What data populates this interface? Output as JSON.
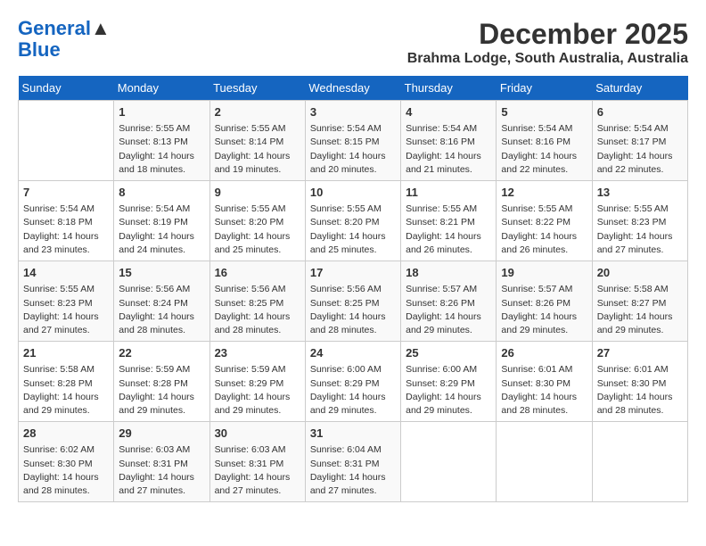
{
  "header": {
    "logo_line1": "General",
    "logo_line2": "Blue",
    "month": "December 2025",
    "location": "Brahma Lodge, South Australia, Australia"
  },
  "weekdays": [
    "Sunday",
    "Monday",
    "Tuesday",
    "Wednesday",
    "Thursday",
    "Friday",
    "Saturday"
  ],
  "weeks": [
    [
      {
        "day": "",
        "sunrise": "",
        "sunset": "",
        "daylight": ""
      },
      {
        "day": "1",
        "sunrise": "Sunrise: 5:55 AM",
        "sunset": "Sunset: 8:13 PM",
        "daylight": "Daylight: 14 hours and 18 minutes."
      },
      {
        "day": "2",
        "sunrise": "Sunrise: 5:55 AM",
        "sunset": "Sunset: 8:14 PM",
        "daylight": "Daylight: 14 hours and 19 minutes."
      },
      {
        "day": "3",
        "sunrise": "Sunrise: 5:54 AM",
        "sunset": "Sunset: 8:15 PM",
        "daylight": "Daylight: 14 hours and 20 minutes."
      },
      {
        "day": "4",
        "sunrise": "Sunrise: 5:54 AM",
        "sunset": "Sunset: 8:16 PM",
        "daylight": "Daylight: 14 hours and 21 minutes."
      },
      {
        "day": "5",
        "sunrise": "Sunrise: 5:54 AM",
        "sunset": "Sunset: 8:16 PM",
        "daylight": "Daylight: 14 hours and 22 minutes."
      },
      {
        "day": "6",
        "sunrise": "Sunrise: 5:54 AM",
        "sunset": "Sunset: 8:17 PM",
        "daylight": "Daylight: 14 hours and 22 minutes."
      }
    ],
    [
      {
        "day": "7",
        "sunrise": "Sunrise: 5:54 AM",
        "sunset": "Sunset: 8:18 PM",
        "daylight": "Daylight: 14 hours and 23 minutes."
      },
      {
        "day": "8",
        "sunrise": "Sunrise: 5:54 AM",
        "sunset": "Sunset: 8:19 PM",
        "daylight": "Daylight: 14 hours and 24 minutes."
      },
      {
        "day": "9",
        "sunrise": "Sunrise: 5:55 AM",
        "sunset": "Sunset: 8:20 PM",
        "daylight": "Daylight: 14 hours and 25 minutes."
      },
      {
        "day": "10",
        "sunrise": "Sunrise: 5:55 AM",
        "sunset": "Sunset: 8:20 PM",
        "daylight": "Daylight: 14 hours and 25 minutes."
      },
      {
        "day": "11",
        "sunrise": "Sunrise: 5:55 AM",
        "sunset": "Sunset: 8:21 PM",
        "daylight": "Daylight: 14 hours and 26 minutes."
      },
      {
        "day": "12",
        "sunrise": "Sunrise: 5:55 AM",
        "sunset": "Sunset: 8:22 PM",
        "daylight": "Daylight: 14 hours and 26 minutes."
      },
      {
        "day": "13",
        "sunrise": "Sunrise: 5:55 AM",
        "sunset": "Sunset: 8:23 PM",
        "daylight": "Daylight: 14 hours and 27 minutes."
      }
    ],
    [
      {
        "day": "14",
        "sunrise": "Sunrise: 5:55 AM",
        "sunset": "Sunset: 8:23 PM",
        "daylight": "Daylight: 14 hours and 27 minutes."
      },
      {
        "day": "15",
        "sunrise": "Sunrise: 5:56 AM",
        "sunset": "Sunset: 8:24 PM",
        "daylight": "Daylight: 14 hours and 28 minutes."
      },
      {
        "day": "16",
        "sunrise": "Sunrise: 5:56 AM",
        "sunset": "Sunset: 8:25 PM",
        "daylight": "Daylight: 14 hours and 28 minutes."
      },
      {
        "day": "17",
        "sunrise": "Sunrise: 5:56 AM",
        "sunset": "Sunset: 8:25 PM",
        "daylight": "Daylight: 14 hours and 28 minutes."
      },
      {
        "day": "18",
        "sunrise": "Sunrise: 5:57 AM",
        "sunset": "Sunset: 8:26 PM",
        "daylight": "Daylight: 14 hours and 29 minutes."
      },
      {
        "day": "19",
        "sunrise": "Sunrise: 5:57 AM",
        "sunset": "Sunset: 8:26 PM",
        "daylight": "Daylight: 14 hours and 29 minutes."
      },
      {
        "day": "20",
        "sunrise": "Sunrise: 5:58 AM",
        "sunset": "Sunset: 8:27 PM",
        "daylight": "Daylight: 14 hours and 29 minutes."
      }
    ],
    [
      {
        "day": "21",
        "sunrise": "Sunrise: 5:58 AM",
        "sunset": "Sunset: 8:28 PM",
        "daylight": "Daylight: 14 hours and 29 minutes."
      },
      {
        "day": "22",
        "sunrise": "Sunrise: 5:59 AM",
        "sunset": "Sunset: 8:28 PM",
        "daylight": "Daylight: 14 hours and 29 minutes."
      },
      {
        "day": "23",
        "sunrise": "Sunrise: 5:59 AM",
        "sunset": "Sunset: 8:29 PM",
        "daylight": "Daylight: 14 hours and 29 minutes."
      },
      {
        "day": "24",
        "sunrise": "Sunrise: 6:00 AM",
        "sunset": "Sunset: 8:29 PM",
        "daylight": "Daylight: 14 hours and 29 minutes."
      },
      {
        "day": "25",
        "sunrise": "Sunrise: 6:00 AM",
        "sunset": "Sunset: 8:29 PM",
        "daylight": "Daylight: 14 hours and 29 minutes."
      },
      {
        "day": "26",
        "sunrise": "Sunrise: 6:01 AM",
        "sunset": "Sunset: 8:30 PM",
        "daylight": "Daylight: 14 hours and 28 minutes."
      },
      {
        "day": "27",
        "sunrise": "Sunrise: 6:01 AM",
        "sunset": "Sunset: 8:30 PM",
        "daylight": "Daylight: 14 hours and 28 minutes."
      }
    ],
    [
      {
        "day": "28",
        "sunrise": "Sunrise: 6:02 AM",
        "sunset": "Sunset: 8:30 PM",
        "daylight": "Daylight: 14 hours and 28 minutes."
      },
      {
        "day": "29",
        "sunrise": "Sunrise: 6:03 AM",
        "sunset": "Sunset: 8:31 PM",
        "daylight": "Daylight: 14 hours and 27 minutes."
      },
      {
        "day": "30",
        "sunrise": "Sunrise: 6:03 AM",
        "sunset": "Sunset: 8:31 PM",
        "daylight": "Daylight: 14 hours and 27 minutes."
      },
      {
        "day": "31",
        "sunrise": "Sunrise: 6:04 AM",
        "sunset": "Sunset: 8:31 PM",
        "daylight": "Daylight: 14 hours and 27 minutes."
      },
      {
        "day": "",
        "sunrise": "",
        "sunset": "",
        "daylight": ""
      },
      {
        "day": "",
        "sunrise": "",
        "sunset": "",
        "daylight": ""
      },
      {
        "day": "",
        "sunrise": "",
        "sunset": "",
        "daylight": ""
      }
    ]
  ]
}
